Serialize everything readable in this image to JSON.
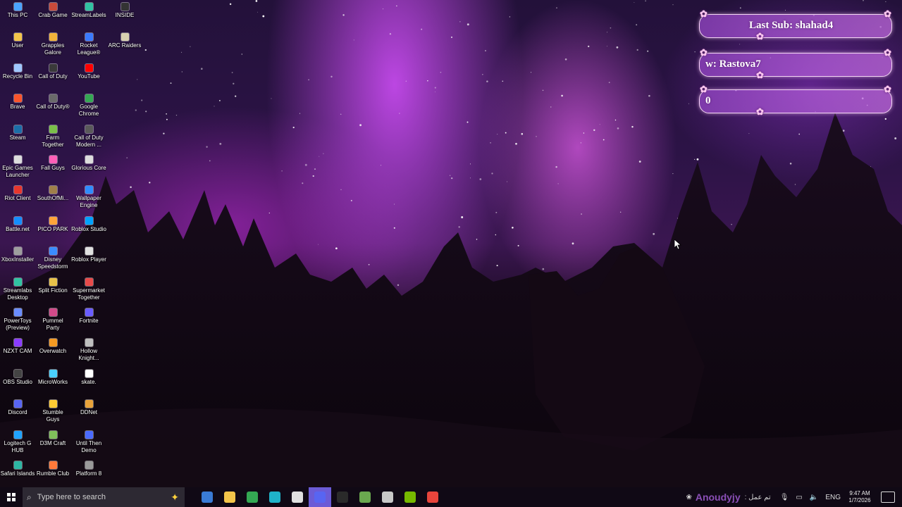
{
  "desktop": {
    "icons": [
      {
        "label": "This PC",
        "color": "#4aa3ff"
      },
      {
        "label": "User",
        "color": "#f3c54a"
      },
      {
        "label": "Recycle Bin",
        "color": "#9fc8ff"
      },
      {
        "label": "Brave",
        "color": "#fb542b"
      },
      {
        "label": "Steam",
        "color": "#1b6ea8"
      },
      {
        "label": "Epic Games Launcher",
        "color": "#dddddd"
      },
      {
        "label": "Riot Client",
        "color": "#e8362d"
      },
      {
        "label": "Battle.net",
        "color": "#148eff"
      },
      {
        "label": "XboxInstaller",
        "color": "#9e9e9e"
      },
      {
        "label": "Streamlabs Desktop",
        "color": "#31c3a2"
      },
      {
        "label": "PowerToys (Preview)",
        "color": "#6a8cff"
      },
      {
        "label": "NZXT CAM",
        "color": "#8a3cff"
      },
      {
        "label": "OBS Studio",
        "color": "#444444"
      },
      {
        "label": "Discord",
        "color": "#5865f2"
      },
      {
        "label": "Logitech G HUB",
        "color": "#1fa3ff"
      },
      {
        "label": "Safari Islands",
        "color": "#2db6a3"
      },
      {
        "label": "Crab Game",
        "color": "#c84a3a"
      },
      {
        "label": "Grapples Galore",
        "color": "#f0b23a"
      },
      {
        "label": "Call of Duty",
        "color": "#3a3a3a"
      },
      {
        "label": "Call of Duty®",
        "color": "#6a6a6a"
      },
      {
        "label": "Farm Together",
        "color": "#7bbf4a"
      },
      {
        "label": "Fall Guys",
        "color": "#ff5fb8"
      },
      {
        "label": "SouthOfMi...",
        "color": "#a0804a"
      },
      {
        "label": "PICO PARK",
        "color": "#ffa43a"
      },
      {
        "label": "Disney Speedstorm",
        "color": "#3a8cff"
      },
      {
        "label": "Split Fiction",
        "color": "#e8c24a"
      },
      {
        "label": "Pummel Party",
        "color": "#d24a8a"
      },
      {
        "label": "Overwatch",
        "color": "#f59a23"
      },
      {
        "label": "MicroWorks",
        "color": "#4ad0ff"
      },
      {
        "label": "Stumble Guys",
        "color": "#ffcc33"
      },
      {
        "label": "D3M Craft",
        "color": "#7fbf5a"
      },
      {
        "label": "Rumble Club",
        "color": "#ff7a3a"
      },
      {
        "label": "StreamLabels",
        "color": "#31c3a2"
      },
      {
        "label": "Rocket League®",
        "color": "#3a7aff"
      },
      {
        "label": "YouTube",
        "color": "#ff0000"
      },
      {
        "label": "Google Chrome",
        "color": "#34a853"
      },
      {
        "label": "Call of Duty Modern ...",
        "color": "#5a5a5a"
      },
      {
        "label": "Glorious Core",
        "color": "#dddddd"
      },
      {
        "label": "Wallpaper Engine",
        "color": "#2f8cff"
      },
      {
        "label": "Roblox Studio",
        "color": "#00a2ff"
      },
      {
        "label": "Roblox Player",
        "color": "#e0e0e0"
      },
      {
        "label": "Supermarket Together",
        "color": "#e84a4a"
      },
      {
        "label": "Fortnite",
        "color": "#6a5cff"
      },
      {
        "label": "Hollow Knight...",
        "color": "#bfbfbf"
      },
      {
        "label": "skate.",
        "color": "#ffffff"
      },
      {
        "label": "DDNet",
        "color": "#e8a33a"
      },
      {
        "label": "Until Then Demo",
        "color": "#4a6aff"
      },
      {
        "label": "Platform 8",
        "color": "#9a9a9a"
      },
      {
        "label": "INSIDE",
        "color": "#333333"
      },
      {
        "label": "ARC Raiders",
        "color": "#d8d0b0"
      }
    ]
  },
  "widgets": {
    "last_sub": "Last Sub: shahad4",
    "follow": "w: Rastova7",
    "count": "0"
  },
  "taskbar": {
    "search_placeholder": "Type here to search",
    "apps": [
      {
        "name": "microsoft-store",
        "color": "#3a7bd5"
      },
      {
        "name": "file-explorer",
        "color": "#f3c54a"
      },
      {
        "name": "google-chrome",
        "color": "#34a853"
      },
      {
        "name": "microsoft-edge",
        "color": "#1fb3c9"
      },
      {
        "name": "settings-like",
        "color": "#e0e0e0"
      },
      {
        "name": "discord",
        "color": "#5865f2"
      },
      {
        "name": "steam",
        "color": "#2a2a2a"
      },
      {
        "name": "minecraft",
        "color": "#6aa84f"
      },
      {
        "name": "blocky-app",
        "color": "#c8c8c8"
      },
      {
        "name": "nvidia-app",
        "color": "#76b900"
      },
      {
        "name": "chrome-profile",
        "color": "#e8453c"
      }
    ],
    "overlay_name": "Anoudyjy",
    "arabic_text": ": تم عمل",
    "language": "ENG",
    "time": "9:47 AM",
    "date": "1/7/2026"
  }
}
